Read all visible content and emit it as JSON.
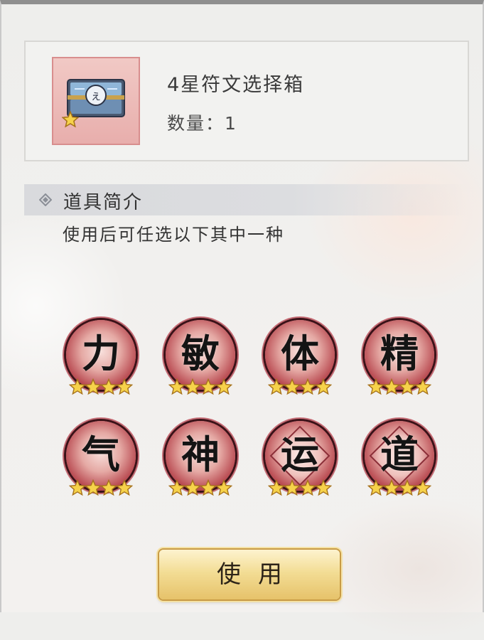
{
  "item": {
    "name": "4星符文选择箱",
    "quantity_label": "数量：1",
    "icon": "rune-chest-icon",
    "stars": 4
  },
  "section": {
    "title": "道具简介",
    "description": "使用后可任选以下其中一种"
  },
  "runes": [
    {
      "glyph": "力",
      "stars": 4
    },
    {
      "glyph": "敏",
      "stars": 4
    },
    {
      "glyph": "体",
      "stars": 4
    },
    {
      "glyph": "精",
      "stars": 4
    },
    {
      "glyph": "气",
      "stars": 4
    },
    {
      "glyph": "神",
      "stars": 4
    },
    {
      "glyph": "运",
      "stars": 4
    },
    {
      "glyph": "道",
      "stars": 4
    }
  ],
  "button": {
    "use_label": "使用"
  },
  "colors": {
    "rune_red": "#b5424a",
    "star_gold": "#f6d24a",
    "button_gold": "#f3dd95"
  }
}
